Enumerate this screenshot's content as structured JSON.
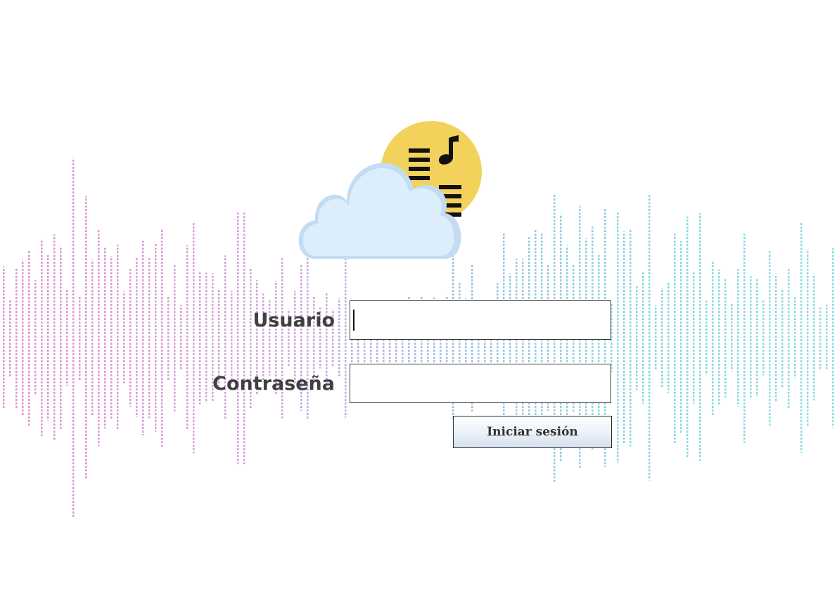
{
  "login": {
    "username_label": "Usuario",
    "password_label": "Contraseña",
    "username_value": "",
    "password_value": "",
    "submit_label": "Iniciar sesión"
  },
  "logo": {
    "icon": "cloud-music-icon",
    "sun_color": "#f2d25a",
    "cloud_color": "#d9ecfb",
    "glyph_color": "#111111"
  },
  "background": {
    "icon": "sound-wave-icon",
    "wave_colors": [
      "#cf3fb3",
      "#7a6fd0",
      "#2ab7c8"
    ]
  }
}
